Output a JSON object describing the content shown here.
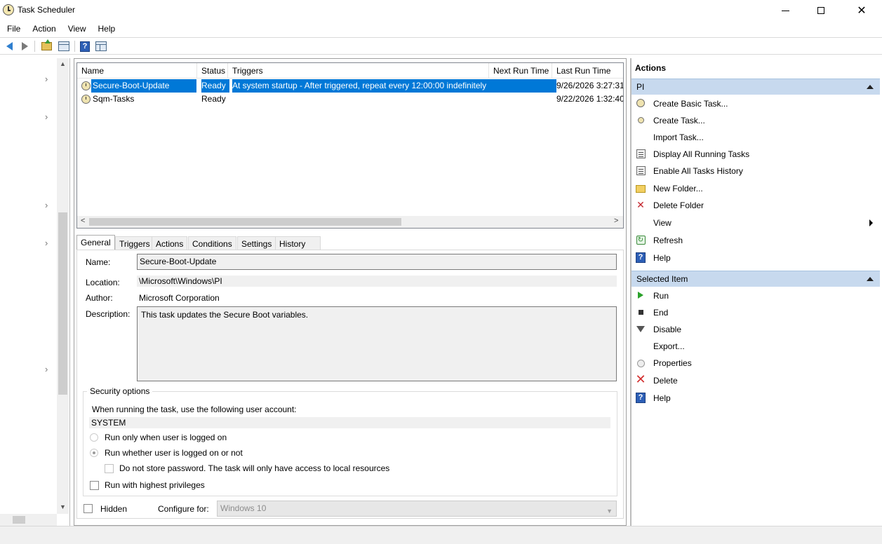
{
  "window": {
    "title": "Task Scheduler",
    "controls": {
      "minimize": "",
      "maximize": "",
      "close": "✕"
    }
  },
  "menu": [
    "File",
    "Action",
    "View",
    "Help"
  ],
  "toolbar": {
    "icons": [
      "back-arrow-icon",
      "forward-arrow-icon",
      "up-folder-icon",
      "show-hide-console-tree-icon",
      "help-icon",
      "show-hide-action-pane-icon"
    ],
    "help_glyph": "?"
  },
  "tree": {
    "chevron": "›",
    "scroll_up": "▲",
    "scroll_down": "▼"
  },
  "task_list": {
    "columns": [
      "Name",
      "Status",
      "Triggers",
      "Next Run Time",
      "Last Run Time"
    ],
    "rows": [
      {
        "name": "Secure-Boot-Update",
        "status": "Ready",
        "triggers": "At system startup - After triggered, repeat every 12:00:00 indefinitely.",
        "next_run": "",
        "last_run": "9/26/2026 3:27:31",
        "selected": true
      },
      {
        "name": "Sqm-Tasks",
        "status": "Ready",
        "triggers": "",
        "next_run": "",
        "last_run": "9/22/2026 1:32:40",
        "selected": false
      }
    ],
    "scroll_left": "<",
    "scroll_right": ">"
  },
  "tabs": [
    "General",
    "Triggers",
    "Actions",
    "Conditions",
    "Settings",
    "History (disabled)"
  ],
  "active_tab": "General",
  "general": {
    "name_label": "Name:",
    "name_value": "Secure-Boot-Update",
    "location_label": "Location:",
    "location_value": "\\Microsoft\\Windows\\PI",
    "author_label": "Author:",
    "author_value": "Microsoft Corporation",
    "description_label": "Description:",
    "description_value": "This task updates the Secure Boot variables.",
    "security": {
      "title": "Security options",
      "account_prompt": "When running the task, use the following user account:",
      "account_value": "SYSTEM",
      "radio_logged_on": "Run only when user is logged on",
      "radio_whether": "Run whether user is logged on or not",
      "selected_radio": "Run whether user is logged on or not",
      "check_no_password": "Do not store password.  The task will only have access to local resources",
      "check_highest": "Run with highest privileges"
    },
    "hidden_label": "Hidden",
    "configure_label": "Configure for:",
    "configure_value": "Windows 10",
    "select_caret": "▼"
  },
  "actions_pane": {
    "title": "Actions",
    "sections": [
      {
        "header": "PI",
        "items": [
          {
            "label": "Create Basic Task...",
            "icon": "clock-icon"
          },
          {
            "label": "Create Task...",
            "icon": "clock-icon"
          },
          {
            "label": "Import Task...",
            "icon": ""
          },
          {
            "label": "Display All Running Tasks",
            "icon": "list-icon"
          },
          {
            "label": "Enable All Tasks History",
            "icon": "history-icon"
          },
          {
            "label": "New Folder...",
            "icon": "folder-icon"
          },
          {
            "label": "Delete Folder",
            "icon": "delete-x-icon"
          },
          {
            "label": "View",
            "icon": ""
          },
          {
            "label": "Refresh",
            "icon": "refresh-icon"
          },
          {
            "label": "Help",
            "icon": "help-icon"
          }
        ]
      },
      {
        "header": "Selected Item",
        "items": [
          {
            "label": "Run",
            "icon": "play-icon"
          },
          {
            "label": "End",
            "icon": "stop-icon"
          },
          {
            "label": "Disable",
            "icon": "disable-arrow-icon"
          },
          {
            "label": "Export...",
            "icon": ""
          },
          {
            "label": "Properties",
            "icon": "properties-icon"
          },
          {
            "label": "Delete",
            "icon": "delete-x-icon"
          },
          {
            "label": "Help",
            "icon": "help-icon"
          }
        ]
      }
    ],
    "delete_glyph": "✕",
    "refresh_glyph": "↻"
  },
  "colors": {
    "selection": "#0078d7",
    "section_header": "#c7d9ee"
  }
}
